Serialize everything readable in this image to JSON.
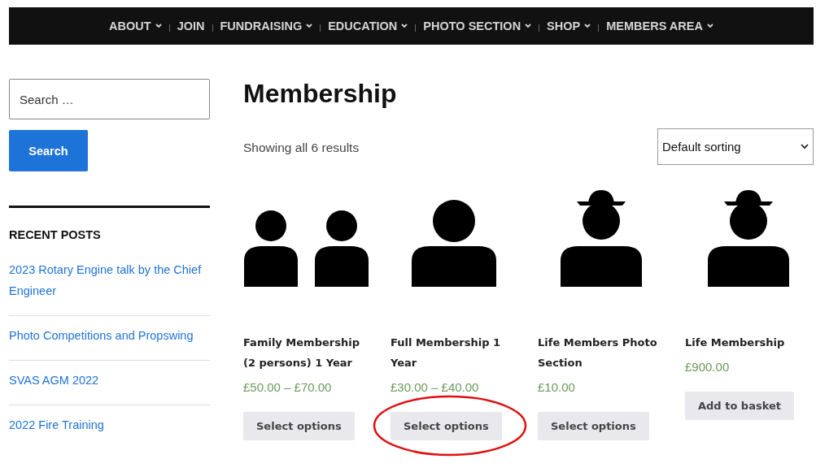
{
  "nav": [
    {
      "label": "ABOUT",
      "dropdown": true
    },
    {
      "label": "JOIN",
      "dropdown": false
    },
    {
      "label": "FUNDRAISING",
      "dropdown": true
    },
    {
      "label": "EDUCATION",
      "dropdown": true
    },
    {
      "label": "PHOTO SECTION",
      "dropdown": true
    },
    {
      "label": "SHOP",
      "dropdown": true
    },
    {
      "label": "MEMBERS AREA",
      "dropdown": true
    }
  ],
  "sidebar": {
    "search": {
      "placeholder": "Search …",
      "button": "Search"
    },
    "recent_posts": {
      "title": "RECENT POSTS",
      "posts": [
        "2023 Rotary Engine talk by the Chief Engineer",
        "Photo Competitions and Propswing",
        "SVAS AGM 2022",
        "2022 Fire Training"
      ]
    }
  },
  "page": {
    "title": "Membership",
    "result_count": "Showing all 6 results",
    "sorting": "Default sorting"
  },
  "products": [
    {
      "kind": "couple",
      "title": "Family Membership (2 persons) 1 Year",
      "price": "£50.00 – £70.00",
      "button": "Select options",
      "circled": false
    },
    {
      "kind": "person",
      "title": "Full Membership 1 Year",
      "price": "£30.00 – £40.00",
      "button": "Select options",
      "circled": true
    },
    {
      "kind": "hat",
      "title": "Life Members Photo Section",
      "price": "£10.00",
      "button": "Select options",
      "circled": false
    },
    {
      "kind": "hat",
      "title": "Life Membership",
      "price": "£900.00",
      "button": "Add to basket",
      "circled": false
    }
  ]
}
